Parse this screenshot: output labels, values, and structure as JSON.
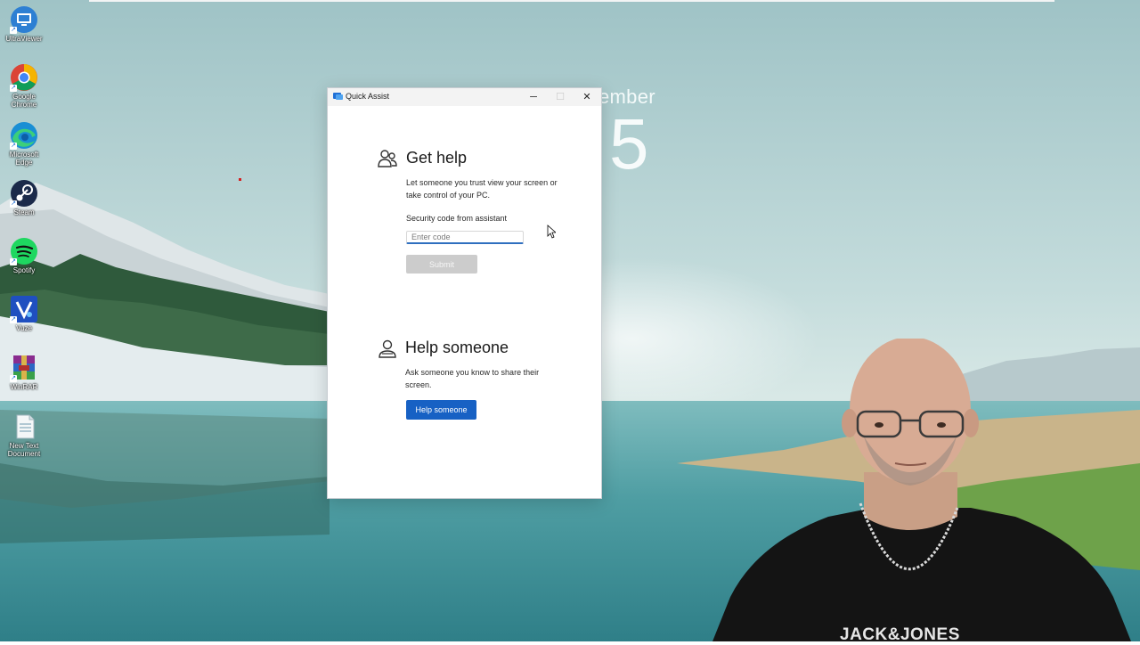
{
  "desktop": {
    "icons": [
      {
        "label": "UltraViewer",
        "icon": "ultraviewer-icon"
      },
      {
        "label": "Google Chrome",
        "icon": "chrome-icon"
      },
      {
        "label": "Microsoft Edge",
        "icon": "edge-icon"
      },
      {
        "label": "Steam",
        "icon": "steam-icon"
      },
      {
        "label": "Spotify",
        "icon": "spotify-icon"
      },
      {
        "label": "Vuze",
        "icon": "vuze-icon"
      },
      {
        "label": "WinRAR",
        "icon": "winrar-icon"
      },
      {
        "label": "New Text Document",
        "icon": "text-document-icon"
      }
    ],
    "widget": {
      "month": "ember",
      "day": "5"
    }
  },
  "window": {
    "title": "Quick Assist",
    "controls": {
      "minimize": "─",
      "maximize": "☐",
      "close": "✕"
    },
    "get_help": {
      "title": "Get help",
      "description": "Let someone you trust view your screen or take control of your PC.",
      "code_label": "Security code from assistant",
      "code_value": "",
      "code_placeholder": "Enter code",
      "submit_label": "Submit"
    },
    "help_someone": {
      "title": "Help someone",
      "description": "Ask someone you know to share their screen.",
      "button_label": "Help someone"
    }
  },
  "webcam": {
    "shirt_text": "JACK&JONES"
  },
  "colors": {
    "accent": "#1761c4",
    "disabled_button": "#cccccc",
    "input_underline": "#2f6fbf"
  }
}
